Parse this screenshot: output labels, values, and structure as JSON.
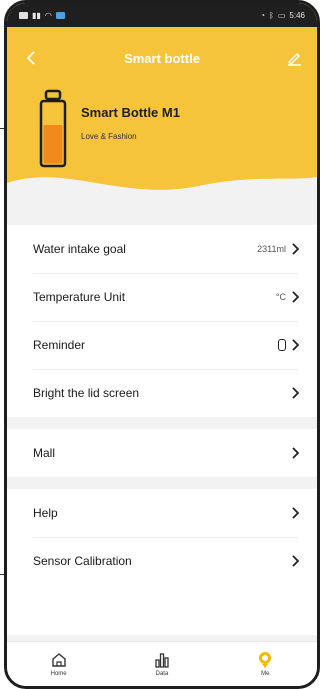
{
  "status_bar": {
    "time": "5:46"
  },
  "nav": {
    "title": "Smart bottle"
  },
  "device": {
    "name": "Smart Bottle M1",
    "subtitle": "Love & Fashion"
  },
  "settings": {
    "water_goal": {
      "label": "Water intake goal",
      "value": "2311ml"
    },
    "temp_unit": {
      "label": "Temperature Unit",
      "value": "°C"
    },
    "reminder": {
      "label": "Reminder"
    },
    "bright_lid": {
      "label": "Bright the lid screen"
    },
    "mall": {
      "label": "Mall"
    },
    "help": {
      "label": "Help"
    },
    "sensor": {
      "label": "Sensor Calibration"
    }
  },
  "tabs": [
    {
      "label": "Home",
      "icon": "home-icon"
    },
    {
      "label": "Data",
      "icon": "bar-chart-icon"
    },
    {
      "label": "Me",
      "icon": "me-icon"
    }
  ],
  "colors": {
    "accent": "#f5c43a",
    "bottle_fill": "#f08a1c",
    "active_tab": "#f5b800"
  }
}
